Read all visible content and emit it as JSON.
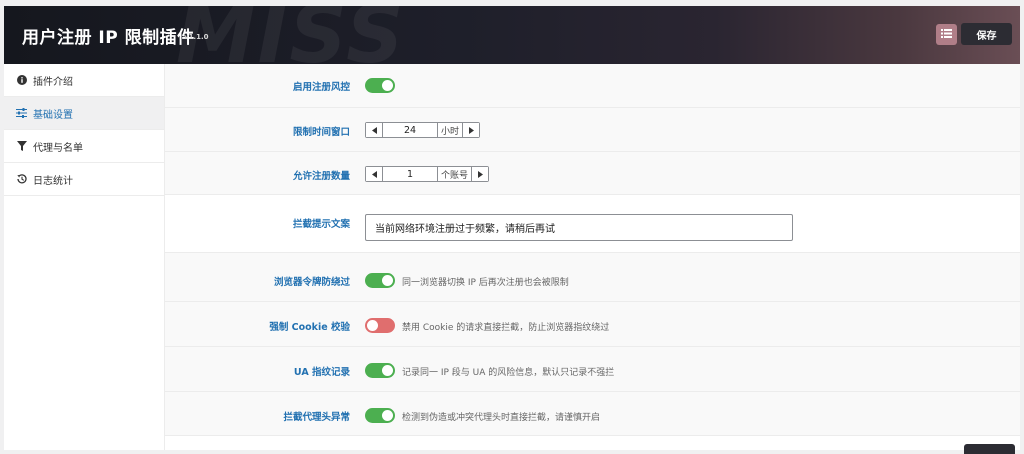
{
  "header": {
    "title": "用户注册 IP 限制插件",
    "version": "v1.1.0",
    "watermark": "MISS",
    "icon_button": "list-icon",
    "save_label": "保存"
  },
  "sidebar": {
    "items": [
      {
        "label": "插件介绍",
        "icon": "info-icon"
      },
      {
        "label": "基础设置",
        "icon": "sliders-icon",
        "active": true
      },
      {
        "label": "代理与名单",
        "icon": "filter-icon"
      },
      {
        "label": "日志统计",
        "icon": "history-icon"
      }
    ]
  },
  "settings": {
    "enable_risk": {
      "label": "启用注册风控",
      "state": "on"
    },
    "time_window": {
      "label": "限制时间窗口",
      "value": "24",
      "unit": "小时"
    },
    "max_accounts": {
      "label": "允许注册数量",
      "value": "1",
      "unit": "个账号"
    },
    "block_message": {
      "label": "拦截提示文案",
      "value": "当前网络环境注册过于频繁，请稍后再试"
    },
    "browser_token": {
      "label": "浏览器令牌防绕过",
      "state": "on",
      "desc": "同一浏览器切换 IP 后再次注册也会被限制"
    },
    "force_cookie": {
      "label": "强制 Cookie 校验",
      "state": "off",
      "desc": "禁用 Cookie 的请求直接拦截，防止浏览器指纹绕过"
    },
    "ua_fingerprint": {
      "label": "UA 指纹记录",
      "state": "on",
      "desc": "记录同一 IP 段与 UA 的风险信息，默认只记录不强拦"
    },
    "proxy_header": {
      "label": "拦截代理头异常",
      "state": "on",
      "desc": "检测到伪造或冲突代理头时直接拦截，请谨慎开启"
    }
  },
  "colors": {
    "accent": "#2271b1",
    "toggle_on": "#4caf50",
    "toggle_off": "#e06e6e",
    "header_dark": "#15171e"
  }
}
